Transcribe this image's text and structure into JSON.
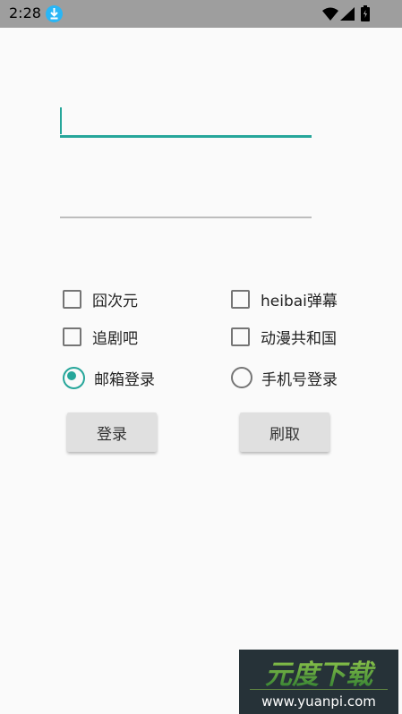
{
  "status_bar": {
    "time": "2:28",
    "icons": [
      "download-icon",
      "wifi-icon",
      "signal-icon",
      "battery-icon"
    ]
  },
  "form": {
    "username": {
      "value": "",
      "placeholder": ""
    },
    "password": {
      "value": "",
      "placeholder": ""
    }
  },
  "checkboxes": [
    {
      "label": "囧次元",
      "checked": false
    },
    {
      "label": "heibai弹幕",
      "checked": false
    },
    {
      "label": "追剧吧",
      "checked": false
    },
    {
      "label": "动漫共和国",
      "checked": false
    }
  ],
  "radios": [
    {
      "label": "邮箱登录",
      "checked": true
    },
    {
      "label": "手机号登录",
      "checked": false
    }
  ],
  "buttons": {
    "login": "登录",
    "fetch": "刷取"
  },
  "watermark": {
    "brand": "元度下载",
    "url": "www.yuanpi.com"
  },
  "colors": {
    "accent": "#26a69a",
    "status_bar": "#9e9e9e",
    "button_bg": "#e0e0e0"
  }
}
